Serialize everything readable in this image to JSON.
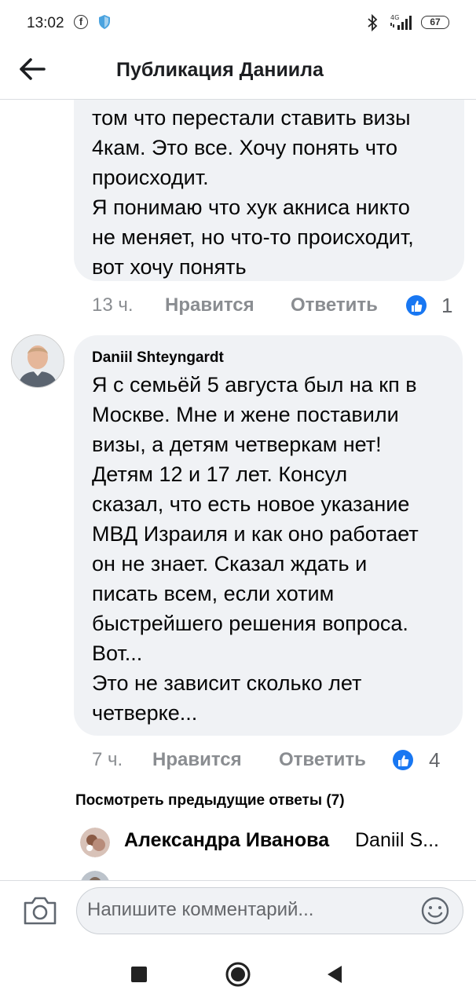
{
  "status_bar": {
    "time": "13:02",
    "network": "4G",
    "battery": "67"
  },
  "header": {
    "title": "Публикация Даниила"
  },
  "comments": [
    {
      "text": "том что перестали ставить визы\n4кам. Это все. Хочу понять что\nпроисходит.\nЯ понимаю что хук акниса никто\nне меняет, но что-то происходит,\nвот хочу понять",
      "time": "13 ч.",
      "like_label": "Нравится",
      "reply_label": "Ответить",
      "reactions": "1"
    },
    {
      "author": "Daniil Shteyngardt",
      "text": "Я с семьёй 5 августа был на кп в\nМоскве. Мне и жене поставили\nвизы, а детям четверкам нет!\nДетям 12 и 17 лет. Консул\nсказал, что есть новое указание\nМВД Израиля и как оно работает\nон не знает. Сказал ждать и\nписать всем, если хотим\nбыстрейшего решения вопроса.\nВот...\nЭто не зависит сколько лет\nчетверке...",
      "time": "7 ч.",
      "like_label": "Нравится",
      "reply_label": "Ответить",
      "reactions": "4"
    }
  ],
  "replies": {
    "view_previous": "Посмотреть предыдущие ответы (7)",
    "items": [
      {
        "author": "Александра Иванова",
        "preview": "Daniil S..."
      }
    ]
  },
  "composer": {
    "placeholder": "Напишите комментарий..."
  },
  "colors": {
    "accent": "#1877f2",
    "bubble": "#f0f2f5",
    "muted": "#8a8d91"
  }
}
